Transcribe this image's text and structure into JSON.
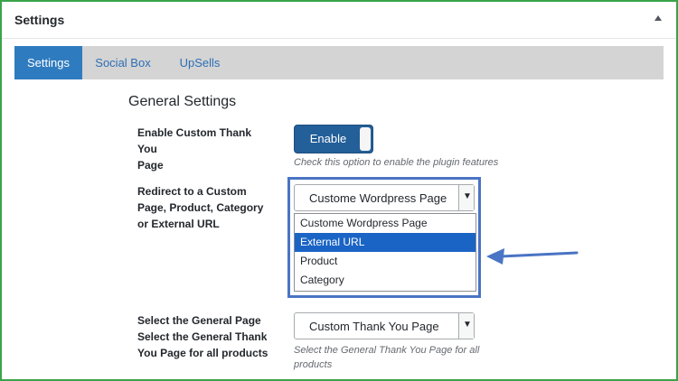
{
  "panel": {
    "title": "Settings"
  },
  "tabs": [
    {
      "label": "Settings"
    },
    {
      "label": "Social Box"
    },
    {
      "label": "UpSells"
    }
  ],
  "section_title": "General Settings",
  "fields": {
    "enable": {
      "label_line1": "Enable Custom Thank You",
      "label_line2": "Page",
      "toggle_label": "Enable",
      "help": "Check this option to enable the plugin features"
    },
    "redirect": {
      "label_line1": "Redirect to a Custom",
      "label_line2": "Page, Product, Category",
      "label_line3": "or External URL",
      "selected": "Custome Wordpress Page",
      "options": [
        "Custome Wordpress Page",
        "External URL",
        "Product",
        "Category"
      ],
      "highlighted_option": "External URL"
    },
    "general_page": {
      "label_line1": "Select the General Page",
      "label_line2": "Select the General Thank",
      "label_line3": "You Page for all products",
      "selected": "Custom Thank You Page",
      "help_line1": "Select the General Thank You Page for all",
      "help_line2": "products"
    }
  },
  "colors": {
    "frame": "#3aa34a",
    "active_tab": "#2f7bbf",
    "toggle": "#235f98",
    "highlight": "#4a74c4",
    "selected_option": "#1a64c5"
  }
}
